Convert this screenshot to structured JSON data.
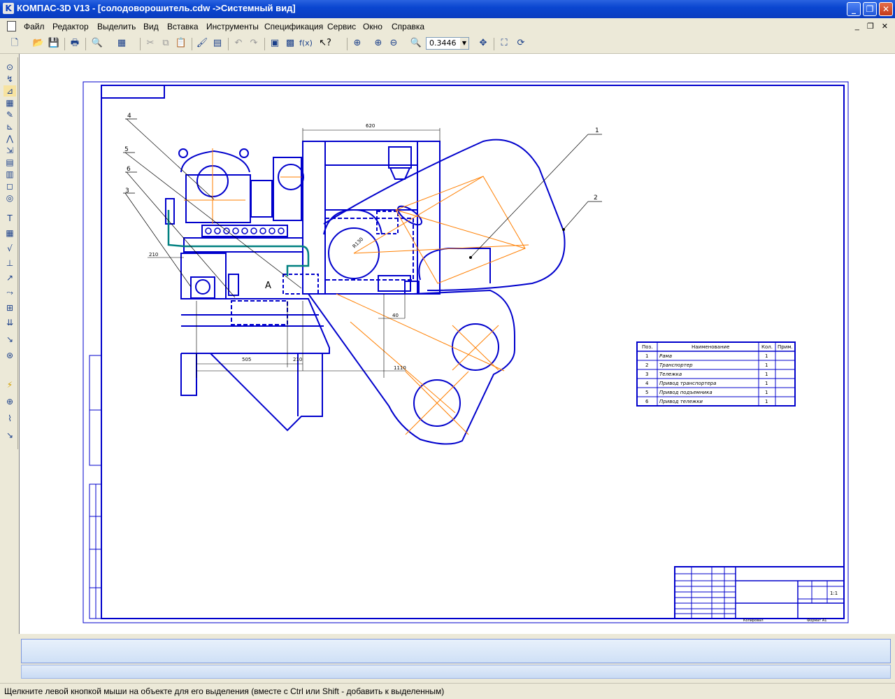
{
  "window": {
    "title": "КОМПАС-3D V13 - [солодоворошитель.cdw ->Системный вид]",
    "app_icon_letter": "K",
    "minimize_glyph": "_",
    "maximize_glyph": "❐",
    "close_glyph": "✕"
  },
  "menu": {
    "items": [
      "Файл",
      "Редактор",
      "Выделить",
      "Вид",
      "Вставка",
      "Инструменты",
      "Спецификация",
      "Сервис",
      "Окно",
      "Справка"
    ],
    "mdi_controls": "_ ❐ ✕"
  },
  "toolbar": {
    "zoom_value": "0.3446"
  },
  "drawing": {
    "dims": {
      "d620": "620",
      "d210a": "210",
      "d505": "505",
      "d210b": "210",
      "d1110": "1110",
      "d40": "40",
      "dR": "R130"
    },
    "section_label": "A",
    "callouts": [
      "1",
      "2",
      "3",
      "4",
      "5",
      "6"
    ],
    "spec_table": {
      "headers": [
        "Поз.",
        "Наименование",
        "Кол.",
        "Прим."
      ],
      "rows": [
        {
          "pos": "1",
          "name": "Рама",
          "qty": "1"
        },
        {
          "pos": "2",
          "name": "Транспортер",
          "qty": "1"
        },
        {
          "pos": "3",
          "name": "Тележка",
          "qty": "1"
        },
        {
          "pos": "4",
          "name": "Привод транспортера",
          "qty": "1"
        },
        {
          "pos": "5",
          "name": "Привод подъемника",
          "qty": "1"
        },
        {
          "pos": "6",
          "name": "Привод тележки",
          "qty": "1"
        }
      ]
    },
    "title_block": {
      "scale": "1:1",
      "copied": "Копировал",
      "format": "Формат  А1"
    }
  },
  "status": {
    "hint": "Щелкните левой кнопкой мыши на объекте для его выделения (вместе с Ctrl или Shift - добавить к выделенным)"
  },
  "colors": {
    "drawing_line": "#0000CC",
    "center_line": "#FF7F00",
    "pipe": "#008080",
    "titlebar": "#0A46D0"
  }
}
